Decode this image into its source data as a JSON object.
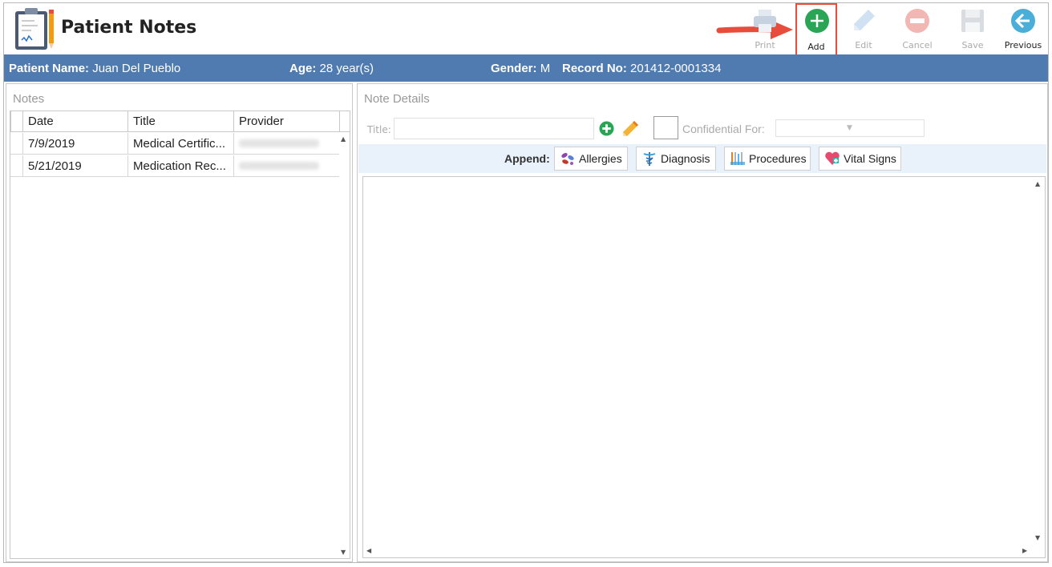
{
  "header": {
    "title": "Patient Notes"
  },
  "toolbar": {
    "print_label": "Print",
    "add_label": "Add",
    "edit_label": "Edit",
    "cancel_label": "Cancel",
    "save_label": "Save",
    "previous_label": "Previous"
  },
  "patient": {
    "name_label": "Patient Name:",
    "name_value": "Juan Del Pueblo",
    "age_label": "Age:",
    "age_value": "28 year(s)",
    "gender_label": "Gender:",
    "gender_value": "M",
    "record_label": "Record No:",
    "record_value": "201412-0001334"
  },
  "notes": {
    "title": "Notes",
    "columns": [
      "Date",
      "Title",
      "Provider"
    ],
    "rows": [
      {
        "date": "7/9/2019",
        "title": "Medical Certific...",
        "provider": ""
      },
      {
        "date": "5/21/2019",
        "title": "Medication Rec...",
        "provider": ""
      }
    ]
  },
  "details": {
    "title": "Note Details",
    "title_field_label": "Title:",
    "title_field_value": "",
    "confidential_label": "Confidential For:",
    "confidential_value": "",
    "append_label": "Append:",
    "append_buttons": [
      "Allergies",
      "Diagnosis",
      "Procedures",
      "Vital Signs"
    ]
  },
  "colors": {
    "patient_bar": "#4f7bb0",
    "add_accent": "#2aa556",
    "highlight": "#e74c3c"
  }
}
